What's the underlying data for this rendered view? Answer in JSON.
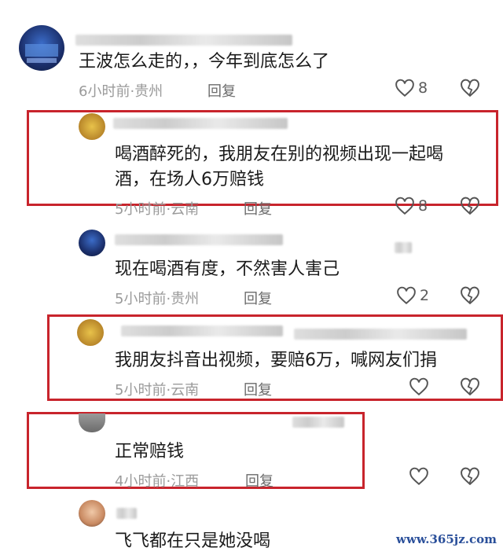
{
  "comments": [
    {
      "text": "王波怎么走的，，今年到底怎么了",
      "time": "6小时前",
      "location": "贵州",
      "reply": "回复",
      "likes": "8"
    },
    {
      "text_line1": "喝酒醉死的，我朋友在别的视频出现一起喝",
      "text_line2": "酒，在场人6万赔钱",
      "time": "5小时前",
      "location": "云南",
      "reply": "回复",
      "likes": "8"
    },
    {
      "text": "现在喝酒有度，不然害人害己",
      "time": "5小时前",
      "location": "贵州",
      "reply": "回复",
      "likes": "2"
    },
    {
      "text": "我朋友抖音出视频，要赔6万，喊网友们捐",
      "time": "5小时前",
      "location": "云南",
      "reply": "回复"
    },
    {
      "text": "正常赔钱",
      "time": "4小时前",
      "location": "江西",
      "reply": "回复"
    },
    {
      "text": "飞飞都在只是她没喝"
    }
  ],
  "separator": "·",
  "watermark": "www.365jz.com",
  "colors": {
    "highlight_border": "#c8242c",
    "meta": "#9a9a9a",
    "icon": "#555555"
  }
}
